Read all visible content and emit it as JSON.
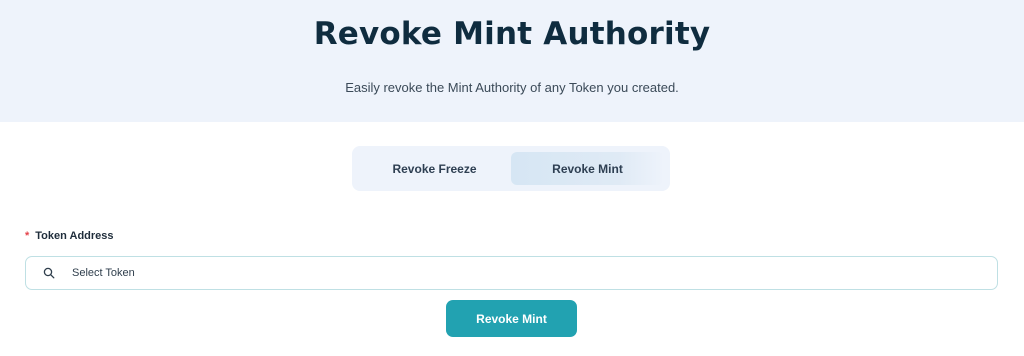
{
  "hero": {
    "title": "Revoke Mint Authority",
    "subtitle": "Easily revoke the Mint Authority of any Token you created."
  },
  "tabs": [
    {
      "label": "Revoke Freeze",
      "active": false
    },
    {
      "label": "Revoke Mint",
      "active": true
    }
  ],
  "form": {
    "required_marker": "*",
    "token_label": "Token Address",
    "token_placeholder": "Select Token",
    "search_icon": "search-icon"
  },
  "action": {
    "label": "Revoke Mint"
  },
  "colors": {
    "accent": "#22a2b1",
    "hero_bg": "#eef3fb",
    "title": "#0f2c3f",
    "required": "#e4434b"
  }
}
